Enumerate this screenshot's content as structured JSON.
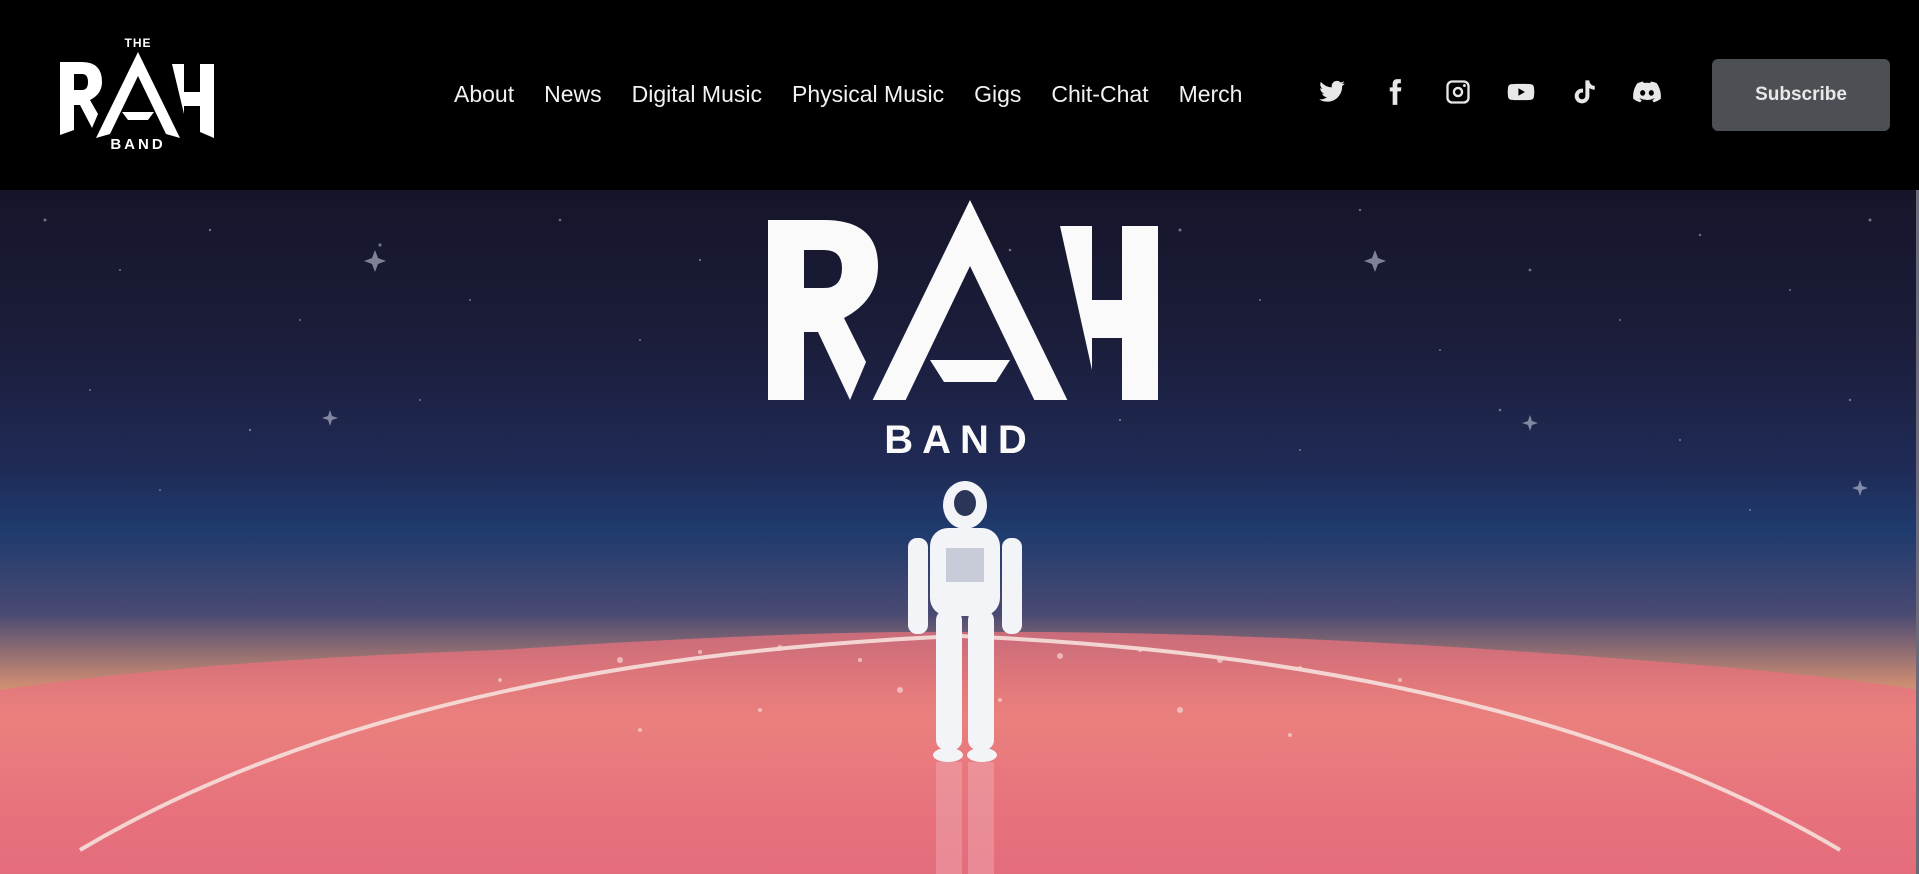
{
  "logo": {
    "the": "THE",
    "main": "RAH",
    "band": "BAND"
  },
  "nav": {
    "items": [
      "About",
      "News",
      "Digital Music",
      "Physical Music",
      "Gigs",
      "Chit-Chat",
      "Merch"
    ]
  },
  "socials": [
    "twitter-icon",
    "facebook-icon",
    "instagram-icon",
    "youtube-icon",
    "tiktok-icon",
    "discord-icon"
  ],
  "subscribe": {
    "label": "Subscribe"
  },
  "hero": {
    "logo_main": "RAH",
    "logo_band": "BAND",
    "image": "astronaut-standing-on-planet"
  },
  "colors": {
    "header_bg": "#000000",
    "subscribe_bg": "#4c5054",
    "sky_top": "#15152a",
    "sky_mid": "#1f3b6e",
    "horizon": "#eeac7e",
    "ground": "#d8607a"
  }
}
